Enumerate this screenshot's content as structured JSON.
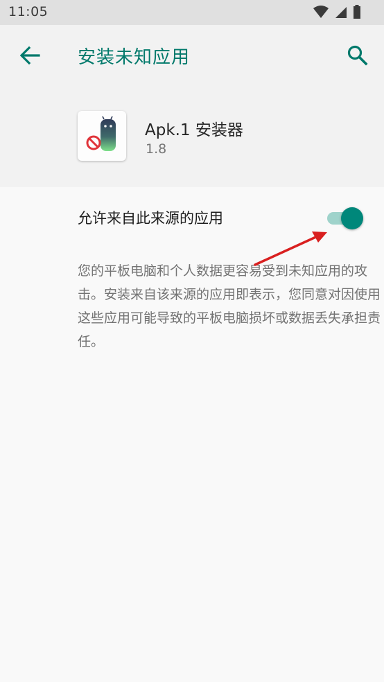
{
  "status_bar": {
    "time": "11:05"
  },
  "appbar": {
    "title": "安装未知应用",
    "back_icon": "arrow-back-icon",
    "search_icon": "search-icon"
  },
  "app_header": {
    "name": "Apk.1 安装器",
    "version": "1.8"
  },
  "setting": {
    "label": "允许来自此来源的应用",
    "enabled": true
  },
  "description": "您的平板电脑和个人数据更容易受到未知应用的攻击。安装来自该来源的应用即表示，您同意对因使用这些应用可能导致的平板电脑损坏或数据丢失承担责任。",
  "colors": {
    "accent": "#00796b",
    "toggle_thumb": "#00877a",
    "toggle_track": "#9fd3cb",
    "annotation_arrow": "#d92020"
  }
}
